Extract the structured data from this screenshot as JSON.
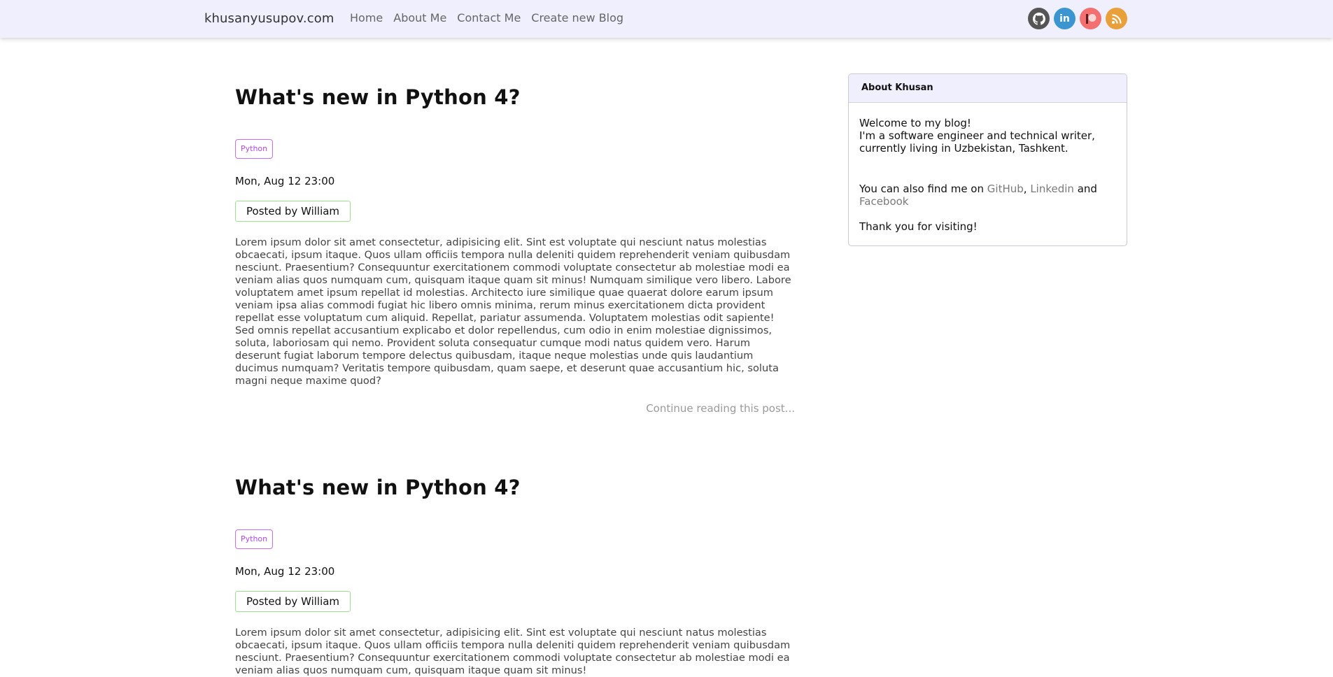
{
  "navbar": {
    "brand": "khusanyusupov.com",
    "links": [
      "Home",
      "About Me",
      "Contact Me",
      "Create new Blog"
    ],
    "social": [
      {
        "name": "github",
        "icon": "github-icon",
        "color": "#555555"
      },
      {
        "name": "linkedin",
        "icon": "linkedin-icon",
        "color": "#3a95d0",
        "text": "in"
      },
      {
        "name": "patreon",
        "icon": "patreon-icon",
        "color": "#f47070"
      },
      {
        "name": "rss",
        "icon": "rss-icon",
        "color": "#e9a03b"
      }
    ]
  },
  "posts": [
    {
      "title": "What's new in Python 4?",
      "tag": "Python",
      "date": "Mon, Aug 12 23:00",
      "author": "Posted by William",
      "excerpt": "Lorem ipsum dolor sit amet consectetur, adipisicing elit. Sint est voluptate qui nesciunt natus molestias obcaecati, ipsum itaque. Quos ullam officiis tempora nulla deleniti quidem reprehenderit veniam quibusdam nesciunt. Praesentium? Consequuntur exercitationem commodi voluptate consectetur ab molestiae modi ea veniam alias quos numquam cum, quisquam itaque quam sit minus! Numquam similique vero libero. Labore voluptatem amet ipsum repellat id molestias. Architecto iure similique quae quaerat dolore earum ipsum veniam ipsa alias commodi fugiat hic libero omnis minima, rerum minus exercitationem dicta provident repellat esse voluptatum cum aliquid. Repellat, pariatur assumenda. Voluptatem molestias odit sapiente! Sed omnis repellat accusantium explicabo et dolor repellendus, cum odio in enim molestiae dignissimos, soluta, laboriosam qui nemo. Provident soluta consequatur cumque modi natus quidem vero. Harum deserunt fugiat laborum tempore delectus quibusdam, itaque neque molestias unde quis laudantium ducimus numquam? Veritatis tempore quibusdam, quam saepe, et deserunt quae accusantium hic, soluta magni neque maxime quod?",
      "continue": "Continue reading this post..."
    },
    {
      "title": "What's new in Python 4?",
      "tag": "Python",
      "date": "Mon, Aug 12 23:00",
      "author": "Posted by William",
      "excerpt": "Lorem ipsum dolor sit amet consectetur, adipisicing elit. Sint est voluptate qui nesciunt natus molestias obcaecati, ipsum itaque. Quos ullam officiis tempora nulla deleniti quidem reprehenderit veniam quibusdam nesciunt. Praesentium? Consequuntur exercitationem commodi voluptate consectetur ab molestiae modi ea veniam alias quos numquam cum, quisquam itaque quam sit minus!"
    }
  ],
  "about": {
    "heading": "About Khusan",
    "welcome": "Welcome to my blog!",
    "bio": "I'm a software engineer and technical writer, currently living in Uzbekistan, Tashkent.",
    "find_prefix": "You can also find me on",
    "github": "GitHub",
    "comma": ",",
    "linkedin": "Linkedin",
    "and": "and",
    "facebook": "Facebook",
    "thanks": "Thank you for visiting!"
  }
}
